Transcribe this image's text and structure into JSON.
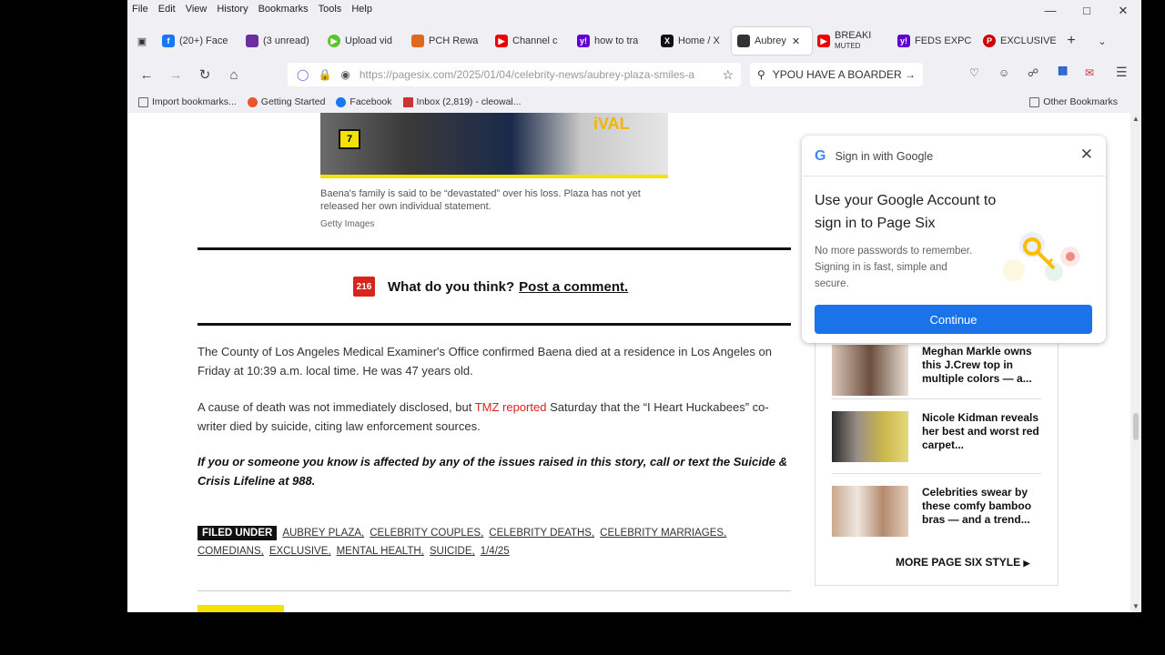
{
  "menu": [
    "File",
    "Edit",
    "View",
    "History",
    "Bookmarks",
    "Tools",
    "Help"
  ],
  "tabs": [
    {
      "label": "(20+) Face",
      "icon": "facebook-icon",
      "color": "#1877f2"
    },
    {
      "label": "(3 unread)",
      "icon": "mail-icon",
      "color": "#6b2fa0"
    },
    {
      "label": "Upload vid",
      "icon": "rumble-icon",
      "color": "#5bc42a"
    },
    {
      "label": "PCH Rewa",
      "icon": "pch-icon",
      "color": "#e06a1b"
    },
    {
      "label": "Channel c",
      "icon": "youtube-icon",
      "color": "#e00"
    },
    {
      "label": "how to tra",
      "icon": "yahoo-icon",
      "color": "#6001d2"
    },
    {
      "label": "Home / X",
      "icon": "x-icon",
      "color": "#111"
    },
    {
      "label": "Aubrey",
      "icon": "pagesix-icon",
      "color": "#333",
      "active": true
    },
    {
      "label": "BREAKI",
      "sub": "MUTED",
      "icon": "youtube-icon",
      "color": "#e00"
    },
    {
      "label": "FEDS EXPC",
      "icon": "yahoo-icon",
      "color": "#6001d2"
    },
    {
      "label": "EXCLUSIVE",
      "icon": "pinterest-icon",
      "color": "#c00"
    }
  ],
  "url": "https://pagesix.com/2025/01/04/celebrity-news/aubrey-plaza-smiles-a",
  "search_text": "YPOU HAVE A BOARDER",
  "bookmarks": [
    "Import bookmarks...",
    "Getting Started",
    "Facebook",
    "Inbox (2,819) - cleowal..."
  ],
  "other_bookmarks": "Other Bookmarks",
  "article": {
    "photo_badge": "7",
    "photo_text": "iVAL",
    "caption": "Baena's family is said to be “devastated” over his loss. Plaza has not yet released her own individual statement.",
    "credit": "Getty Images",
    "comment_count": "216",
    "comment_prompt": "What do you think?",
    "comment_link": "Post a comment.",
    "p1": "The County of Los Angeles Medical Examiner's Office confirmed Baena died at a residence in Los Angeles on Friday at 10:39 a.m. local time. He was 47 years old.",
    "p2a": "A cause of death was not immediately disclosed, but ",
    "p2link": "TMZ reported",
    "p2b": " Saturday that the “I Heart Huckabees” co-writer died by suicide, citing law enforcement sources.",
    "p3": "If you or someone you know is affected by any of the issues raised in this story, call or text the Suicide & Crisis Lifeline at 988.",
    "filed_under": "FILED UNDER",
    "tags": [
      "AUBREY PLAZA,",
      "CELEBRITY COUPLES,",
      "CELEBRITY DEATHS,",
      "CELEBRITY MARRIAGES,",
      "COMEDIANS,",
      "EXCLUSIVE,",
      "MENTAL HEALTH,",
      "SUICIDE,",
      "1/4/25"
    ]
  },
  "sidebar": {
    "items": [
      "Meghan Markle owns this J.Crew top in multiple colors — a...",
      "Nicole Kidman reveals her best and worst red carpet...",
      "Celebrities swear by these comfy bamboo bras — and a trend..."
    ],
    "more": "MORE PAGE SIX STYLE"
  },
  "google": {
    "header": "Sign in with Google",
    "title": "Use your Google Account to sign in to Page Six",
    "desc": "No more passwords to remember. Signing in is fast, simple and secure.",
    "button": "Continue"
  }
}
